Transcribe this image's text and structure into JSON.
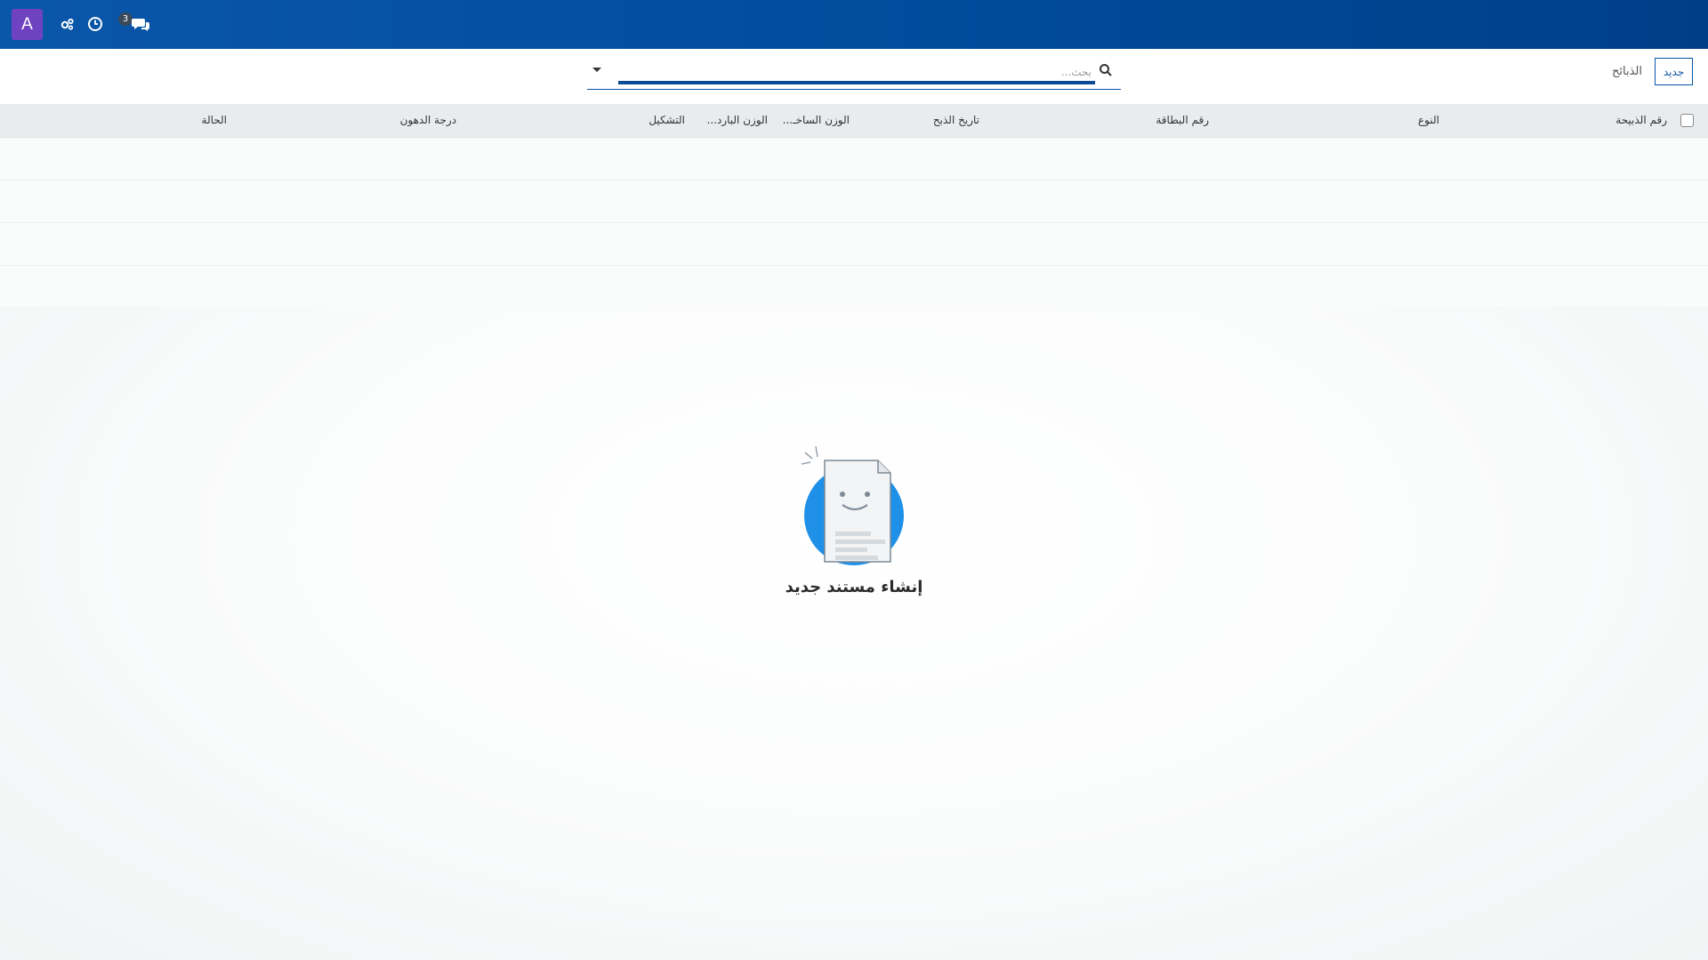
{
  "navbar": {
    "avatar_letter": "A",
    "icons": [
      "settings-icon",
      "clock-icon",
      "chat-icon"
    ],
    "chat_badge_count": "3",
    "brand_color": "#0a56a8"
  },
  "control_panel": {
    "new_button_label": "جديد",
    "breadcrumb": "الذبائح",
    "search_placeholder": "بحث..."
  },
  "table": {
    "columns": [
      "رقم الذبيحة",
      "النوع",
      "رقم البطاقة",
      "تاريخ الذبح",
      "الوزن الساخـ...",
      "الوزن البارد...",
      "التشكيل",
      "درجة الدهون",
      "الحالة"
    ]
  },
  "helper": {
    "title": "إنشاء مستند جديد"
  }
}
